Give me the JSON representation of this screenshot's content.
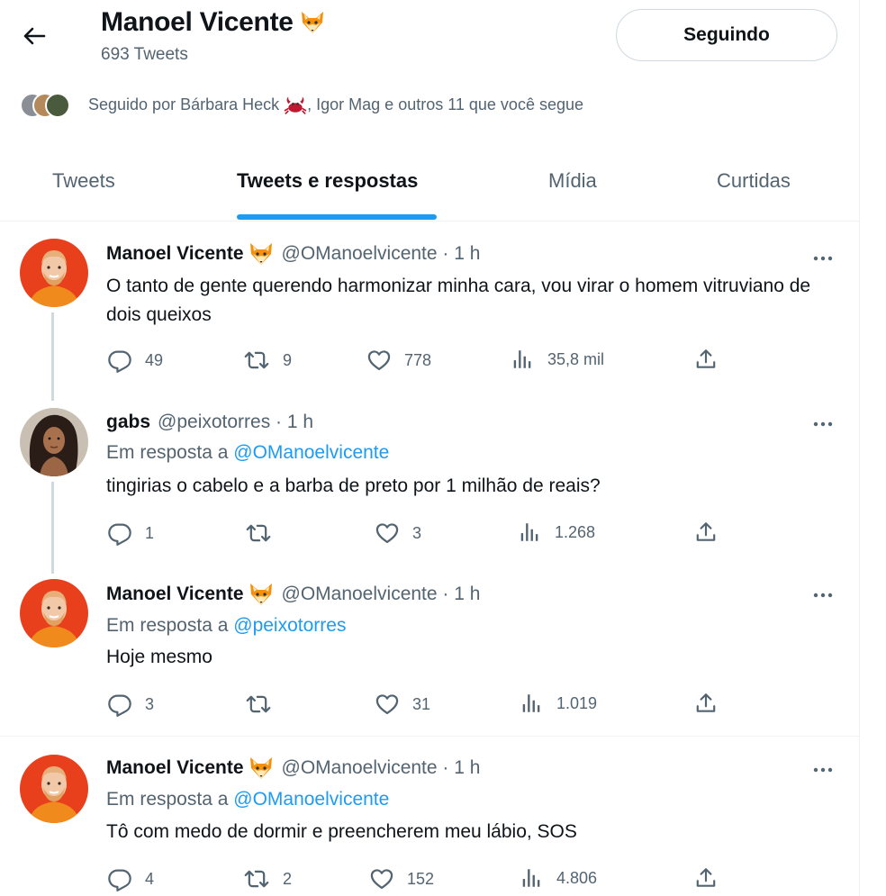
{
  "header": {
    "name": "Manoel Vicente",
    "name_emoji_icon": "fox-emoji-icon",
    "tweet_count": "693 Tweets",
    "follow_button": "Seguindo"
  },
  "followed_by": {
    "prefix": "Seguido por Bárbara Heck",
    "crab_icon": "crab-emoji-icon",
    "suffix": ", Igor Mag e outros 11 que você segue"
  },
  "tabs": [
    {
      "label": "Tweets",
      "active": false
    },
    {
      "label": "Tweets e respostas",
      "active": true
    },
    {
      "label": "Mídia",
      "active": false
    },
    {
      "label": "Curtidas",
      "active": false
    }
  ],
  "tweets": [
    {
      "name": "Manoel Vicente",
      "handle": "@OManoelvicente · 1 h",
      "reply_prefix": "",
      "reply_to": "",
      "text": "O tanto de gente querendo harmonizar minha cara, vou virar o homem vitruviano de dois queixos",
      "replies": "49",
      "retweets": "9",
      "likes": "778",
      "views": "35,8 mil"
    },
    {
      "name": "gabs",
      "handle": "@peixotorres · 1 h",
      "reply_prefix": "Em resposta a",
      "reply_to": "@OManoelvicente",
      "text": "tingirias o cabelo e a barba de preto por 1 milhão de reais?",
      "replies": "1",
      "retweets": "",
      "likes": "3",
      "views": "1.268"
    },
    {
      "name": "Manoel Vicente",
      "handle": "@OManoelvicente · 1 h",
      "reply_prefix": "Em resposta a",
      "reply_to": "@peixotorres",
      "text": "Hoje mesmo",
      "replies": "3",
      "retweets": "",
      "likes": "31",
      "views": "1.019"
    },
    {
      "name": "Manoel Vicente",
      "handle": "@OManoelvicente · 1 h",
      "reply_prefix": "Em resposta a",
      "reply_to": "@OManoelvicente",
      "text": "Tô com medo de dormir e preencherem meu lábio, SOS",
      "replies": "4",
      "retweets": "2",
      "likes": "152",
      "views": "4.806"
    }
  ],
  "colors": {
    "accent": "#1d9bf0",
    "secondary_text": "#536471",
    "primary_text": "#0f1419"
  }
}
